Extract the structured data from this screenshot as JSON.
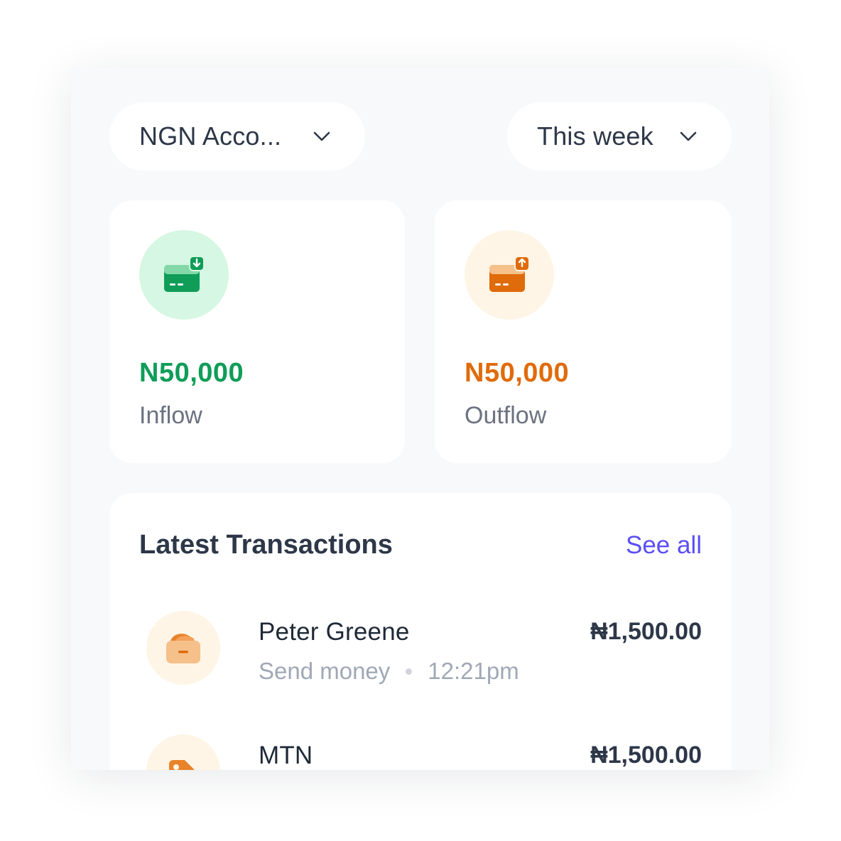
{
  "filters": {
    "account": "NGN Acco...",
    "period": "This week"
  },
  "inflow": {
    "amount": "N50,000",
    "label": "Inflow",
    "color": "#0f9d58"
  },
  "outflow": {
    "amount": "N50,000",
    "label": "Outflow",
    "color": "#e06b0a"
  },
  "transactions": {
    "title": "Latest Transactions",
    "see_all": "See all",
    "items": [
      {
        "name": "Peter Greene",
        "type": "Send money",
        "time": "12:21pm",
        "amount": "₦1,500.00",
        "icon": "wallet-icon"
      },
      {
        "name": "MTN",
        "amount": "₦1,500.00",
        "icon": "tag-icon"
      }
    ]
  },
  "colors": {
    "accent": "#5b4ff5",
    "background": "#f8f9fb"
  }
}
